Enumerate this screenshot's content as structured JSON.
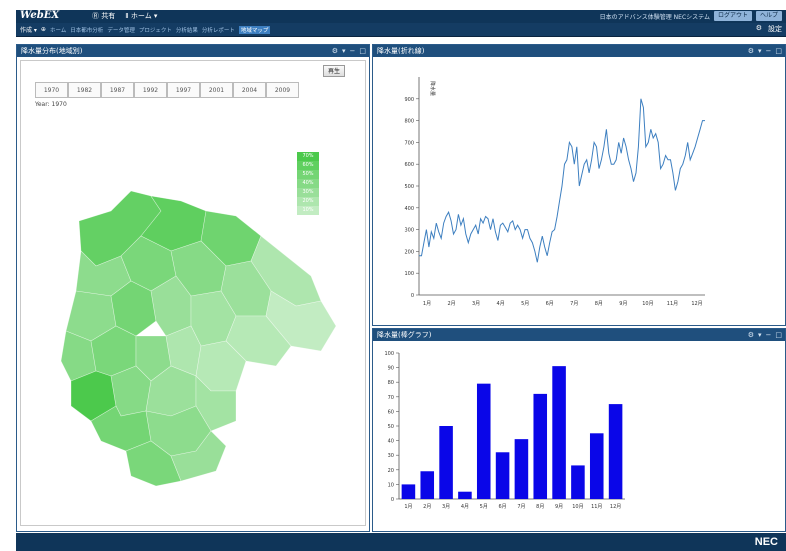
{
  "app": {
    "brand": "WebEX",
    "user_label": "共有",
    "nav_items": [
      "Ⓡ 共有",
      "Ⅱ ホーム ▾"
    ],
    "right_text": "日本のアドバンス体験管理 NECシステム",
    "right_buttons": [
      "ログアウト",
      "ヘルプ"
    ]
  },
  "menubar": {
    "left_items": [
      "作成 ▾",
      "⊕"
    ],
    "crumbs": [
      "ホーム",
      "日本都市分析",
      "データ管理",
      "プロジェクト",
      "分析結果",
      "分析レポート"
    ],
    "active_crumb": "地域マップ",
    "right_items": [
      "⚙",
      "設定"
    ]
  },
  "panels": {
    "map": {
      "title": "降水量分布(地域別)",
      "controls": [
        "⚙",
        "▾",
        "−",
        "□"
      ],
      "play_label": "再生",
      "years": [
        "1970",
        "1982",
        "1987",
        "1992",
        "1997",
        "2001",
        "2004",
        "2009"
      ],
      "year_label": "Year: 1970",
      "legend": [
        {
          "label": "70%",
          "color": "#4cc94c"
        },
        {
          "label": "60%",
          "color": "#5fd05f"
        },
        {
          "label": "50%",
          "color": "#74d574"
        },
        {
          "label": "40%",
          "color": "#86da86"
        },
        {
          "label": "30%",
          "color": "#99df99"
        },
        {
          "label": "20%",
          "color": "#aee6ae"
        },
        {
          "label": "10%",
          "color": "#c2ecc2"
        }
      ]
    },
    "line": {
      "title": "降水量(折れ線)",
      "controls": [
        "⚙",
        "▾",
        "−",
        "□"
      ]
    },
    "bar": {
      "title": "降水量(棒グラフ)",
      "controls": [
        "⚙",
        "▾",
        "−",
        "□"
      ]
    }
  },
  "footer": {
    "logo": "NEC"
  },
  "chart_data": [
    {
      "type": "line",
      "ylabel": "降水量",
      "ylim": [
        0,
        1000
      ],
      "yticks": [
        0,
        100,
        200,
        300,
        400,
        500,
        600,
        700,
        800,
        900
      ],
      "xticks": [
        "1月",
        "2月",
        "3月",
        "4月",
        "5月",
        "6月",
        "7月",
        "8月",
        "9月",
        "10月",
        "11月",
        "12月"
      ],
      "series": [
        {
          "values": [
            180,
            180,
            240,
            300,
            220,
            290,
            260,
            330,
            290,
            260,
            330,
            360,
            380,
            340,
            280,
            300,
            370,
            320,
            350,
            280,
            240,
            280,
            300,
            320,
            280,
            350,
            330,
            360,
            350,
            300,
            350,
            290,
            250,
            320,
            330,
            310,
            290,
            330,
            340,
            300,
            320,
            300,
            260,
            300,
            300,
            260,
            240,
            200,
            150,
            220,
            270,
            220,
            180,
            240,
            290,
            300,
            360,
            430,
            500,
            600,
            620,
            700,
            680,
            600,
            680,
            500,
            550,
            600,
            620,
            560,
            620,
            700,
            680,
            580,
            620,
            680,
            760,
            650,
            600,
            600,
            620,
            700,
            650,
            720,
            680,
            620,
            580,
            520,
            560,
            680,
            900,
            860,
            680,
            700,
            760,
            720,
            740,
            700,
            580,
            600,
            640,
            620,
            620,
            560,
            480,
            520,
            580,
            600,
            640,
            700,
            620,
            650,
            680,
            720,
            760,
            800,
            800
          ]
        }
      ]
    },
    {
      "type": "bar",
      "ylim": [
        0,
        100
      ],
      "yticks": [
        0,
        10,
        20,
        30,
        40,
        50,
        60,
        70,
        80,
        90,
        100
      ],
      "categories": [
        "1月",
        "2月",
        "3月",
        "4月",
        "5月",
        "6月",
        "7月",
        "8月",
        "9月",
        "10月",
        "11月",
        "12月"
      ],
      "values": [
        10,
        19,
        50,
        5,
        79,
        32,
        41,
        72,
        91,
        23,
        45,
        65
      ],
      "color": "#0a06e8"
    }
  ]
}
